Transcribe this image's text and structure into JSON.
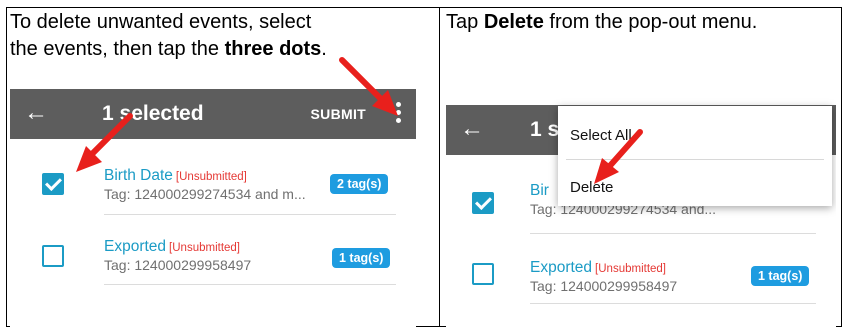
{
  "left": {
    "instruction": {
      "line1": "To delete unwanted events, select",
      "line2_prefix": "the events, then tap the ",
      "line2_bold": "three dots",
      "line2_suffix": "."
    },
    "appbar": {
      "title": "1 selected",
      "submit": "SUBMIT"
    },
    "rows": [
      {
        "name": "Birth Date",
        "status": "[Unsubmitted]",
        "tag": "Tag: 124000299274534 and m...",
        "badge": "2 tag(s)",
        "checked": true
      },
      {
        "name": "Exported",
        "status": "[Unsubmitted]",
        "tag": "Tag: 124000299958497",
        "badge": "1 tag(s)",
        "checked": false
      }
    ]
  },
  "right": {
    "instruction": {
      "prefix": "Tap ",
      "bold": "Delete",
      "suffix": " from the pop-out menu."
    },
    "appbar": {
      "title": "1 s"
    },
    "menu": {
      "select_all": "Select All",
      "delete": "Delete"
    },
    "rows": [
      {
        "name": "Bir",
        "tag": "Tag: 124000299274534 and...",
        "checked": true
      },
      {
        "name": "Exported",
        "status": "[Unsubmitted]",
        "tag": "Tag: 124000299958497",
        "badge": "1 tag(s)",
        "checked": false
      }
    ]
  },
  "colors": {
    "accent": "#1b9bc5",
    "badge": "#1e9ce0",
    "appbar": "#5d5d5d",
    "unsubmitted": "#e53935",
    "arrow": "#e8201c"
  }
}
